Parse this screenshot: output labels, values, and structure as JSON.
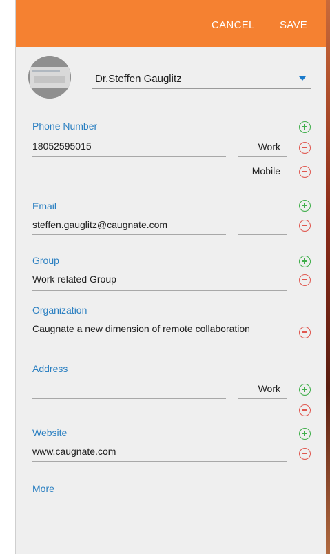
{
  "header": {
    "cancel_label": "CANCEL",
    "save_label": "SAVE"
  },
  "contact": {
    "name": "Dr.Steffen Gauglitz"
  },
  "phone": {
    "label": "Phone Number",
    "entries": [
      {
        "value": "18052595015",
        "type": "Work"
      },
      {
        "value": "",
        "type": "Mobile"
      }
    ]
  },
  "email": {
    "label": "Email",
    "value": "steffen.gauglitz@caugnate.com",
    "type": ""
  },
  "group": {
    "label": "Group",
    "value": "Work related Group"
  },
  "organization": {
    "label": "Organization",
    "value": "Caugnate a new dimension of remote collaboration"
  },
  "address": {
    "label": "Address",
    "value": "",
    "type": "Work"
  },
  "website": {
    "label": "Website",
    "value": "www.caugnate.com"
  },
  "more": {
    "label": "More"
  },
  "colors": {
    "accent": "#f58131",
    "label_blue": "#2a7fc1",
    "add_green": "#3fae4a",
    "remove_red": "#e0574f"
  },
  "icons": {
    "add": "plus-circle-icon",
    "remove": "minus-circle-icon",
    "dropdown": "caret-down-icon"
  }
}
